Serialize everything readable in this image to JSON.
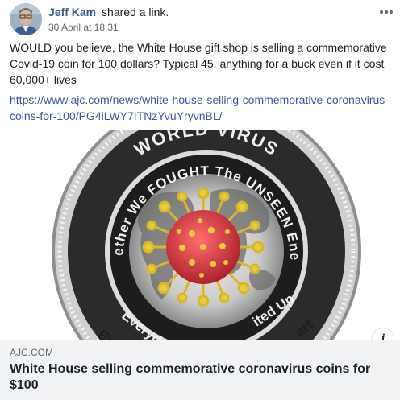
{
  "post": {
    "author": "Jeff Kam",
    "action": "shared a link.",
    "date": "30 April at 18:31",
    "more_icon": "more-dots-icon",
    "text": "WOULD you believe, the White House gift shop is selling a commemorative Covid-19 coin for 100 dollars? Typical 45, anything for a buck even if it cost 60,000+ lives",
    "link": "https://www.ajc.com/news/white-house-selling-commemorative-coronavirus-coins-for-100/PG4iLWY7ITNzYvuYryvnBL/"
  },
  "preview": {
    "coin_text_top": "WORLD VIRUS",
    "coin_text_upper_ring": "Together We FOUGHT The UNSEEN Enemy",
    "coin_text_lower_ring": "Everyday ... United Up ... Apart",
    "info_label": "i",
    "domain": "AJC.COM",
    "title": "White House selling commemorative coronavirus coins for $100"
  },
  "colors": {
    "link": "#385898",
    "caption_bg": "#f2f3f5",
    "virus_red": "#c8303a",
    "virus_yellow": "#e0c230"
  }
}
